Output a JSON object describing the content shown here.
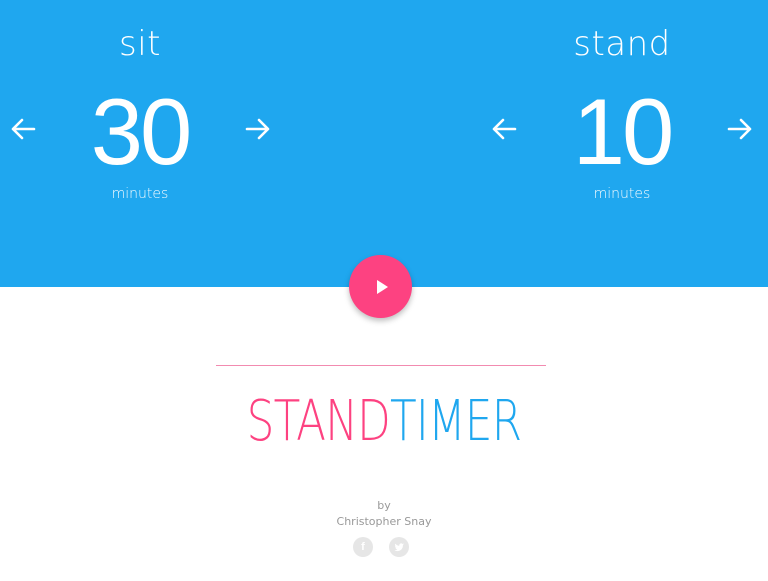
{
  "sit": {
    "label": "sit",
    "value": "30",
    "unit": "minutes"
  },
  "stand": {
    "label": "stand",
    "value": "10",
    "unit": "minutes"
  },
  "brand": {
    "part1": "STAND",
    "part2": "TIMER"
  },
  "credit": {
    "by": "by",
    "author": "Christopher Snay"
  },
  "colors": {
    "accent_blue": "#1fa7ef",
    "accent_pink": "#fd4281"
  },
  "icons": {
    "decrement": "arrow-left-icon",
    "increment": "arrow-right-icon",
    "play": "play-icon",
    "facebook": "facebook-icon",
    "twitter": "twitter-icon"
  }
}
